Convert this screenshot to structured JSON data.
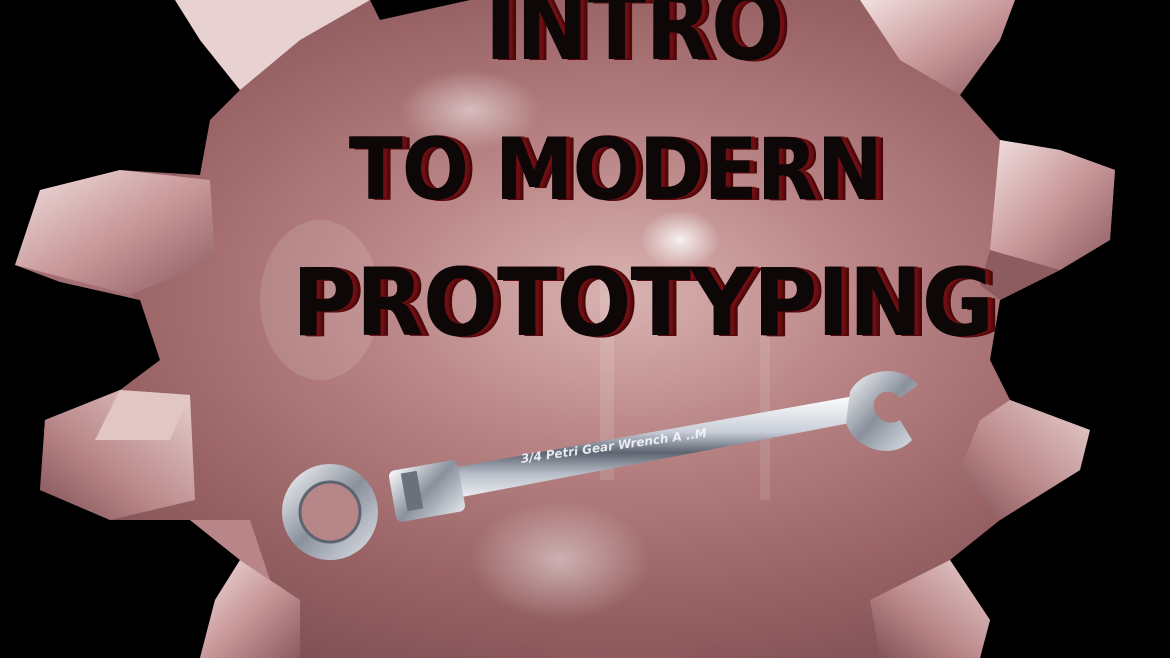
{
  "scene": {
    "background_color": "#000000",
    "gear_color": "#c28f92",
    "gear_highlight": "#e9d3d2",
    "gear_shadow": "#7b4d52",
    "title_fill": "#0d0707",
    "title_extrusion": "#6e0f12"
  },
  "title": {
    "line1": "INTRO",
    "line2": "TO MODERN",
    "line3": "PROTOTYPING"
  },
  "wrench": {
    "engraving": "3/4   Petri Gear Wrench  A  ..M",
    "icon": "wrench-icon"
  },
  "gear": {
    "icon": "gear-icon"
  }
}
